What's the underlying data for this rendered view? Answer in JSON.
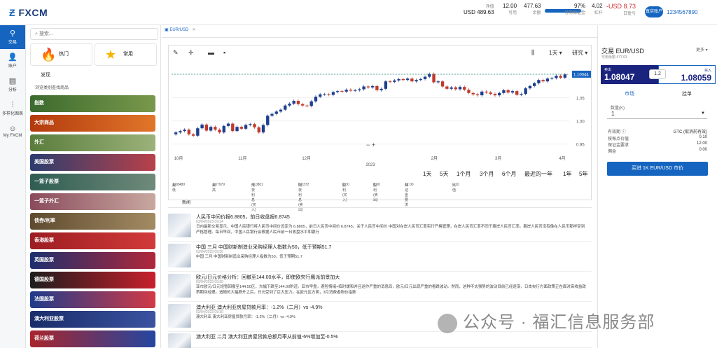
{
  "header": {
    "logo": "FXCM",
    "stats": [
      {
        "label": "净值",
        "value": "USD 489.63"
      },
      {
        "label": "可用",
        "value": "12.00"
      },
      {
        "label": "余额",
        "value": "477.63"
      },
      {
        "label": "可用保证金",
        "value": "97%"
      },
      {
        "label": "杠杆",
        "value": "4.02"
      },
      {
        "label": "日盈亏",
        "value": "-USD 8.73"
      }
    ],
    "margin_level_percent": 97,
    "account_button": "真实账户",
    "account_number": "1234567890",
    "colors": {
      "brand": "#1565c0",
      "negative": "#d32f2f"
    }
  },
  "leftnav": [
    {
      "label": "交易",
      "icon": "search-chart-icon"
    },
    {
      "label": "账户",
      "icon": "person-icon"
    },
    {
      "label": "分析",
      "icon": "document-icon"
    },
    {
      "label": "多样化图表",
      "icon": "chart-icon"
    },
    {
      "label": "My FXCM",
      "icon": "user-icon"
    }
  ],
  "markets": {
    "search_placeholder": "搜索...",
    "favorites": [
      {
        "label": "热门",
        "icon": "fire-icon"
      },
      {
        "label": "常用",
        "icon": "star-icon"
      }
    ],
    "discover_label": "发现",
    "hint": "浏览类别查找商品",
    "categories": [
      "指数",
      "大宗商品",
      "外汇",
      "美国股票",
      "一篮子股票",
      "一篮子外汇",
      "债券/利率",
      "香港股票",
      "英国股票",
      "德国股票",
      "法国股票",
      "澳大利亚股票",
      "荷兰股票"
    ]
  },
  "chart_tab": {
    "label": "EUR/USD"
  },
  "chart": {
    "toolbar_timeframe": "1天",
    "toolbar_research": "研究",
    "current_price_label": "1.10044",
    "periods": [
      "1天",
      "5天",
      "1个月",
      "3个月",
      "6个月",
      "最近的一年",
      "1年",
      "5年"
    ],
    "stats": [
      {
        "label": "最低",
        "value": "1.08480"
      },
      {
        "label": "最高",
        "value": "1.07979"
      },
      {
        "label": "隔夜利息(买入)",
        "value": "-0.0801"
      },
      {
        "label": "隔夜利息(卖出)",
        "value": "0.0372"
      },
      {
        "label": "股利(买入)",
        "value": "0.00"
      },
      {
        "label": "股利(卖出)",
        "value": "0.00"
      },
      {
        "label": "保证金要求",
        "value": "12.00"
      },
      {
        "label": "点值",
        "value": "0.10"
      }
    ]
  },
  "chart_data": {
    "type": "candlestick",
    "x_ticks": [
      "10月",
      "11月",
      "12月",
      "2023",
      "2月",
      "3月",
      "4月"
    ],
    "y_ticks": [
      "1.10",
      "1.05",
      "1.00",
      "0.95"
    ],
    "ylim": [
      0.93,
      1.12
    ],
    "series": [
      {
        "values": [
          0.975,
          0.978,
          0.981,
          0.971,
          0.968,
          0.984,
          0.992,
          0.979,
          0.987,
          0.981,
          0.975,
          0.989,
          0.994,
          0.978,
          0.987,
          0.983,
          0.991,
          0.993,
          0.986,
          0.975,
          0.991,
          1.011,
          1.015,
          1.02,
          1.024,
          1.033,
          1.037,
          1.043,
          1.036,
          1.033,
          1.032,
          1.042,
          1.052,
          1.057,
          1.057,
          1.056,
          1.062,
          1.064,
          1.063,
          1.067,
          1.065,
          1.066,
          1.068,
          1.074,
          1.072,
          1.075,
          1.066,
          1.069,
          1.085,
          1.084,
          1.087,
          1.09,
          1.088,
          1.091,
          1.085,
          1.088,
          1.09,
          1.095,
          1.101,
          1.083,
          1.085,
          1.074,
          1.069,
          1.072,
          1.068,
          1.073,
          1.067,
          1.06,
          1.057,
          1.055,
          1.063,
          1.061,
          1.058,
          1.055,
          1.06,
          1.066,
          1.061,
          1.064,
          1.056,
          1.058,
          1.07,
          1.075,
          1.081,
          1.088,
          1.085,
          1.091,
          1.092,
          1.097,
          1.093,
          1.1
        ]
      }
    ]
  },
  "news": {
    "tab_label": "新闻",
    "items": [
      {
        "title": "人民币中间价报6.8805，前日收盘报6.8745",
        "date": "03/04/2023 09:34",
        "body": "日内最新交易显示，中国人民银行将人民币中间价设定为 6.8805，前日人民币中间价 6.8745。关于人民币中间价    中国对在岸人民币汇率实行严格管理，在岸人民币汇率不同于离岸人民币汇率。离岸人民币没有像在人民币那样受到严格管理。每日早间，中国人民银行会根据人民币前一日收盘水平和银行"
      },
      {
        "title": "中国 三月 中国财新制造业采购经理人指数为50，低于预期51.7",
        "date": "03/04/2023 09:50",
        "body": "中国 三月 中国财新制造业采购经理人指数为50，低于预期51.7"
      },
      {
        "title": "欧元/日元价格分析：回撤至144.00水平，即使欧央行鹰派前景加大",
        "date": "03/04/2023 09:50",
        "body": "亚市欧元/日元短暂回撤至144.50区，大幅下跌至144.00附近。亚市早盘，避险情绪+临时缓和并且运作严重的消息后，欧元/日元出现严重的看跌波动。然而，这种不太强势的波动目前已经逐渐，日本央行方面政策正在面对高收益政策期间经理。追随的大幅跌升之后，日元受到了巨大压力。在欧元区方面，3月消费者物价指数"
      },
      {
        "title": "澳大利亚 澳大利亚房屋贷款月率：-1.2%（二月）vs -4.9%",
        "date": "03/04/2023 09:30",
        "body": "澳大利亚 澳大利亚房屋贷款月率：-1.2%（二月）vs -4.9%"
      },
      {
        "title": "澳大利亚 二月 澳大利亚房屋贷款总额月率从前值-6%增加至-0.5%",
        "date": "03/04/2023 09:30",
        "body": ""
      }
    ]
  },
  "trade": {
    "title": "交易 EUR/USD",
    "subtitle": "可用余额 477.63",
    "more": "更多",
    "sell_label": "卖出",
    "sell_price": "1.08047",
    "buy_label": "买入",
    "buy_price": "1.08059",
    "spread": "1.2",
    "tab_market": "市场",
    "tab_limit": "挂单",
    "qty_label": "数量(K)",
    "qty_value": "1",
    "rows": [
      {
        "label": "有效期",
        "value": "GTC (取消前有效)"
      },
      {
        "label": "按每点价值",
        "value": "0.10"
      },
      {
        "label": "保证金要求",
        "value": "12.00"
      },
      {
        "label": "佣金",
        "value": "0.00"
      }
    ],
    "buy_button": "买进 1K EUR/USD 市价"
  },
  "watermark": "公众号 · 福汇信息服务部"
}
